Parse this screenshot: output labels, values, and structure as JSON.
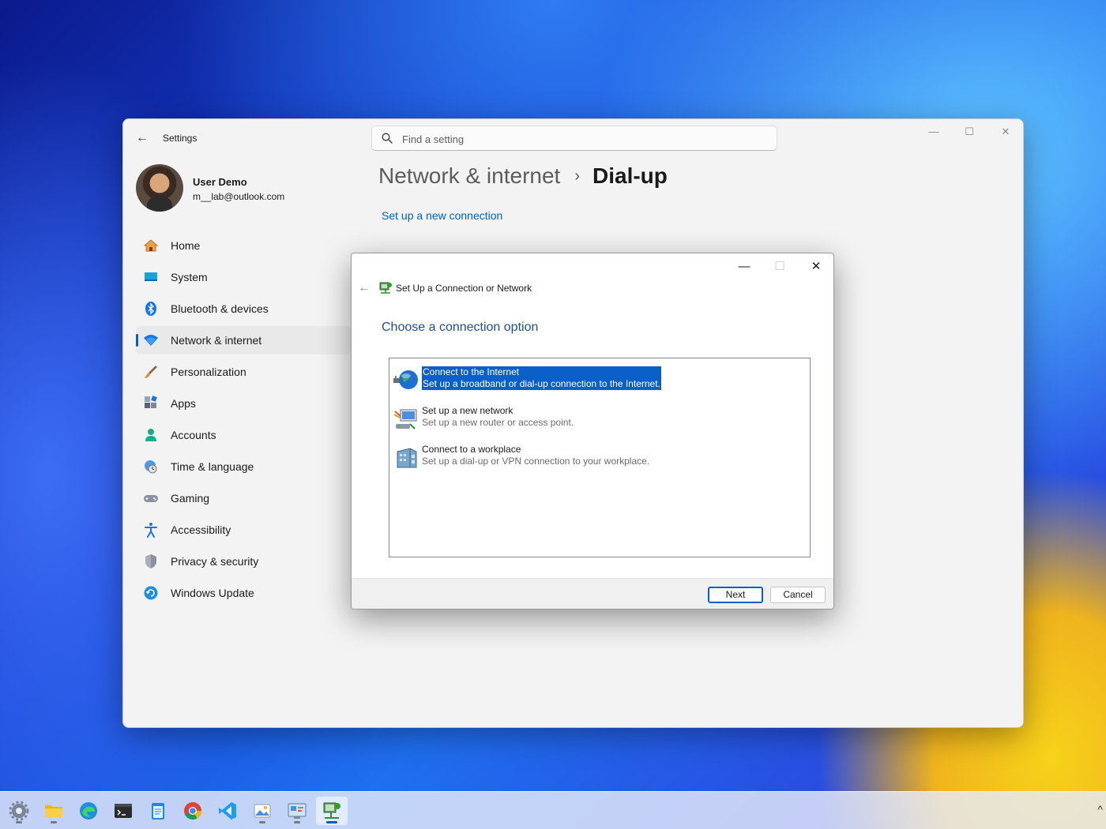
{
  "settings": {
    "app_title": "Settings",
    "search_placeholder": "Find a setting",
    "user": {
      "name": "User Demo",
      "email": "m__lab@outlook.com"
    },
    "nav": [
      {
        "label": "Home",
        "icon": "home-icon"
      },
      {
        "label": "System",
        "icon": "system-icon"
      },
      {
        "label": "Bluetooth & devices",
        "icon": "bluetooth-icon"
      },
      {
        "label": "Network & internet",
        "icon": "wifi-icon",
        "active": true
      },
      {
        "label": "Personalization",
        "icon": "brush-icon"
      },
      {
        "label": "Apps",
        "icon": "apps-icon"
      },
      {
        "label": "Accounts",
        "icon": "account-icon"
      },
      {
        "label": "Time & language",
        "icon": "clock-globe-icon"
      },
      {
        "label": "Gaming",
        "icon": "gamepad-icon"
      },
      {
        "label": "Accessibility",
        "icon": "accessibility-icon"
      },
      {
        "label": "Privacy & security",
        "icon": "shield-icon"
      },
      {
        "label": "Windows Update",
        "icon": "update-icon"
      }
    ],
    "breadcrumb": {
      "parent": "Network & internet",
      "separator": "›",
      "current": "Dial-up"
    },
    "setup_link": "Set up a new connection"
  },
  "dialog": {
    "title": "Set Up a Connection or Network",
    "heading": "Choose a connection option",
    "options": [
      {
        "title": "Connect to the Internet",
        "description": "Set up a broadband or dial-up connection to the Internet.",
        "selected": true,
        "icon": "globe-icon"
      },
      {
        "title": "Set up a new network",
        "description": "Set up a new router or access point.",
        "selected": false,
        "icon": "router-icon"
      },
      {
        "title": "Connect to a workplace",
        "description": "Set up a dial-up or VPN connection to your workplace.",
        "selected": false,
        "icon": "workplace-icon"
      }
    ],
    "next_label": "Next",
    "cancel_label": "Cancel"
  },
  "taskbar": {
    "apps": [
      "settings-icon",
      "file-explorer-icon",
      "edge-icon",
      "terminal-icon",
      "notepad-icon",
      "chrome-icon",
      "vscode-icon",
      "photos-icon",
      "control-panel-icon",
      "network-setup-icon"
    ],
    "active": "network-setup-icon"
  },
  "colors": {
    "accent": "#005fb8",
    "selection": "#0a5fc8",
    "link": "#005fb8",
    "heading": "#1e4e9e"
  }
}
